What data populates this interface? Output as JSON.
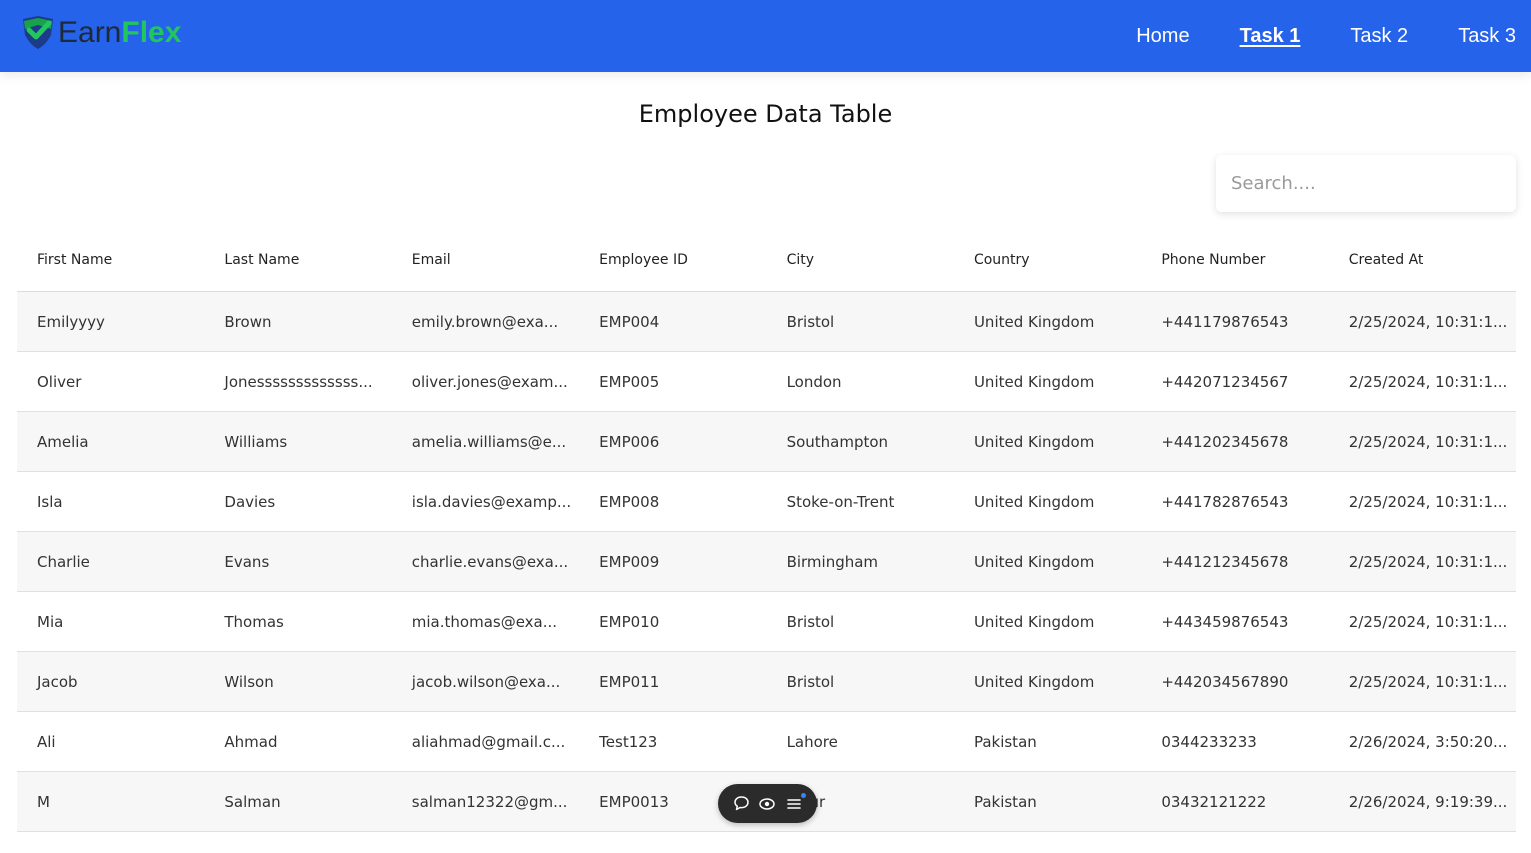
{
  "brand": {
    "earn": "Earn",
    "flex": "Flex"
  },
  "nav": {
    "links": [
      {
        "label": "Home",
        "active": false
      },
      {
        "label": "Task 1",
        "active": true
      },
      {
        "label": "Task 2",
        "active": false
      },
      {
        "label": "Task 3",
        "active": false
      }
    ]
  },
  "page": {
    "title": "Employee Data Table"
  },
  "search": {
    "placeholder": "Search...."
  },
  "table": {
    "columns": [
      "First Name",
      "Last Name",
      "Email",
      "Employee ID",
      "City",
      "Country",
      "Phone Number",
      "Created At"
    ],
    "rows": [
      [
        "Emilyyyy",
        "Brown",
        "emily.brown@exa...",
        "EMP004",
        "Bristol",
        "United Kingdom",
        "+441179876543",
        "2/25/2024, 10:31:1..."
      ],
      [
        "Oliver",
        "Jonesssssssssssss...",
        "oliver.jones@exam...",
        "EMP005",
        "London",
        "United Kingdom",
        "+442071234567",
        "2/25/2024, 10:31:1..."
      ],
      [
        "Amelia",
        "Williams",
        "amelia.williams@e...",
        "EMP006",
        "Southampton",
        "United Kingdom",
        "+441202345678",
        "2/25/2024, 10:31:1..."
      ],
      [
        "Isla",
        "Davies",
        "isla.davies@examp...",
        "EMP008",
        "Stoke-on-Trent",
        "United Kingdom",
        "+441782876543",
        "2/25/2024, 10:31:1..."
      ],
      [
        "Charlie",
        "Evans",
        "charlie.evans@exa...",
        "EMP009",
        "Birmingham",
        "United Kingdom",
        "+441212345678",
        "2/25/2024, 10:31:1..."
      ],
      [
        "Mia",
        "Thomas",
        "mia.thomas@exa...",
        "EMP010",
        "Bristol",
        "United Kingdom",
        "+443459876543",
        "2/25/2024, 10:31:1..."
      ],
      [
        "Jacob",
        "Wilson",
        "jacob.wilson@exa...",
        "EMP011",
        "Bristol",
        "United Kingdom",
        "+442034567890",
        "2/25/2024, 10:31:1..."
      ],
      [
        "Ali",
        "Ahmad",
        "aliahmad@gmail.c...",
        "Test123",
        "Lahore",
        "Pakistan",
        "0344233233",
        "2/26/2024, 3:50:20..."
      ],
      [
        "M",
        "Salman",
        "salman12322@gm...",
        "EMP0013",
        "alpur",
        "Pakistan",
        "03432121222",
        "2/26/2024, 9:19:39..."
      ]
    ]
  },
  "floating_toolbar": {
    "icons": [
      "chat-bubble-icon",
      "eye-icon",
      "menu-list-icon"
    ]
  },
  "colors": {
    "navbar": "#2563eb",
    "brand_green": "#22c55e",
    "row_alt": "#f7f7f7"
  }
}
